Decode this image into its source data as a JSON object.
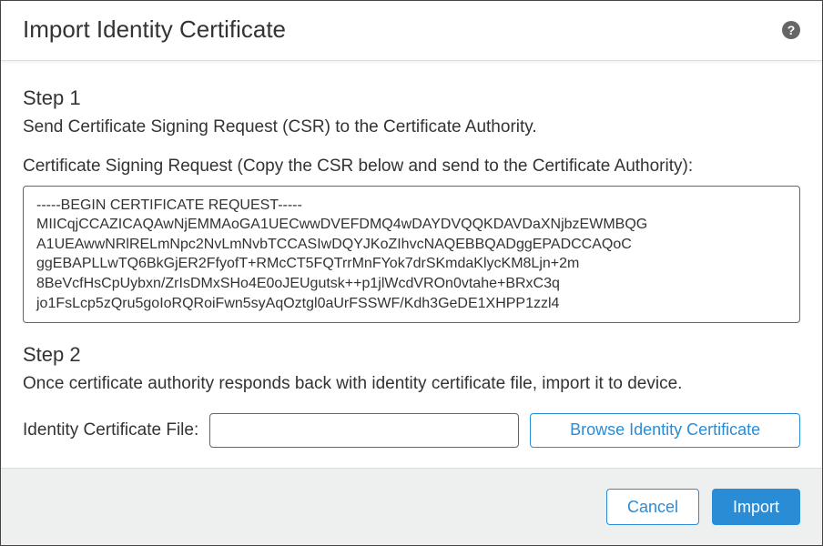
{
  "title": "Import Identity Certificate",
  "help_tooltip": "?",
  "step1": {
    "heading": "Step 1",
    "description": "Send Certificate Signing Request (CSR) to the Certificate Authority.",
    "csr_label": "Certificate Signing Request (Copy the CSR below and send to the Certificate Authority):",
    "csr_text": "-----BEGIN CERTIFICATE REQUEST-----\nMIICqjCCAZICAQAwNjEMMAoGA1UECwwDVEFDMQ4wDAYDVQQKDAVDaXNjbzEWMBQG\nA1UEAwwNRlRELmNpc2NvLmNvbTCCASIwDQYJKoZIhvcNAQEBBQADggEPADCCAQoC\nggEBAPLLwTQ6BkGjER2FfyofT+RMcCT5FQTrrMnFYok7drSKmdaKlycKM8Ljn+2m\n8BeVcfHsCpUybxn/ZrIsDMxSHo4E0oJEUgutsk++p1jlWcdVROn0vtahe+BRxC3q\njo1FsLcp5zQru5goIoRQRoiFwn5syAqOztgl0aUrFSSWF/Kdh3GeDE1XHPP1zzl4"
  },
  "step2": {
    "heading": "Step 2",
    "description": "Once certificate authority responds back with identity certificate file, import it to device.",
    "file_label": "Identity Certificate File:",
    "file_value": "",
    "browse_label": "Browse Identity Certificate"
  },
  "footer": {
    "cancel_label": "Cancel",
    "import_label": "Import"
  },
  "colors": {
    "accent": "#2b8cd6",
    "footer_bg": "#eeefef"
  }
}
